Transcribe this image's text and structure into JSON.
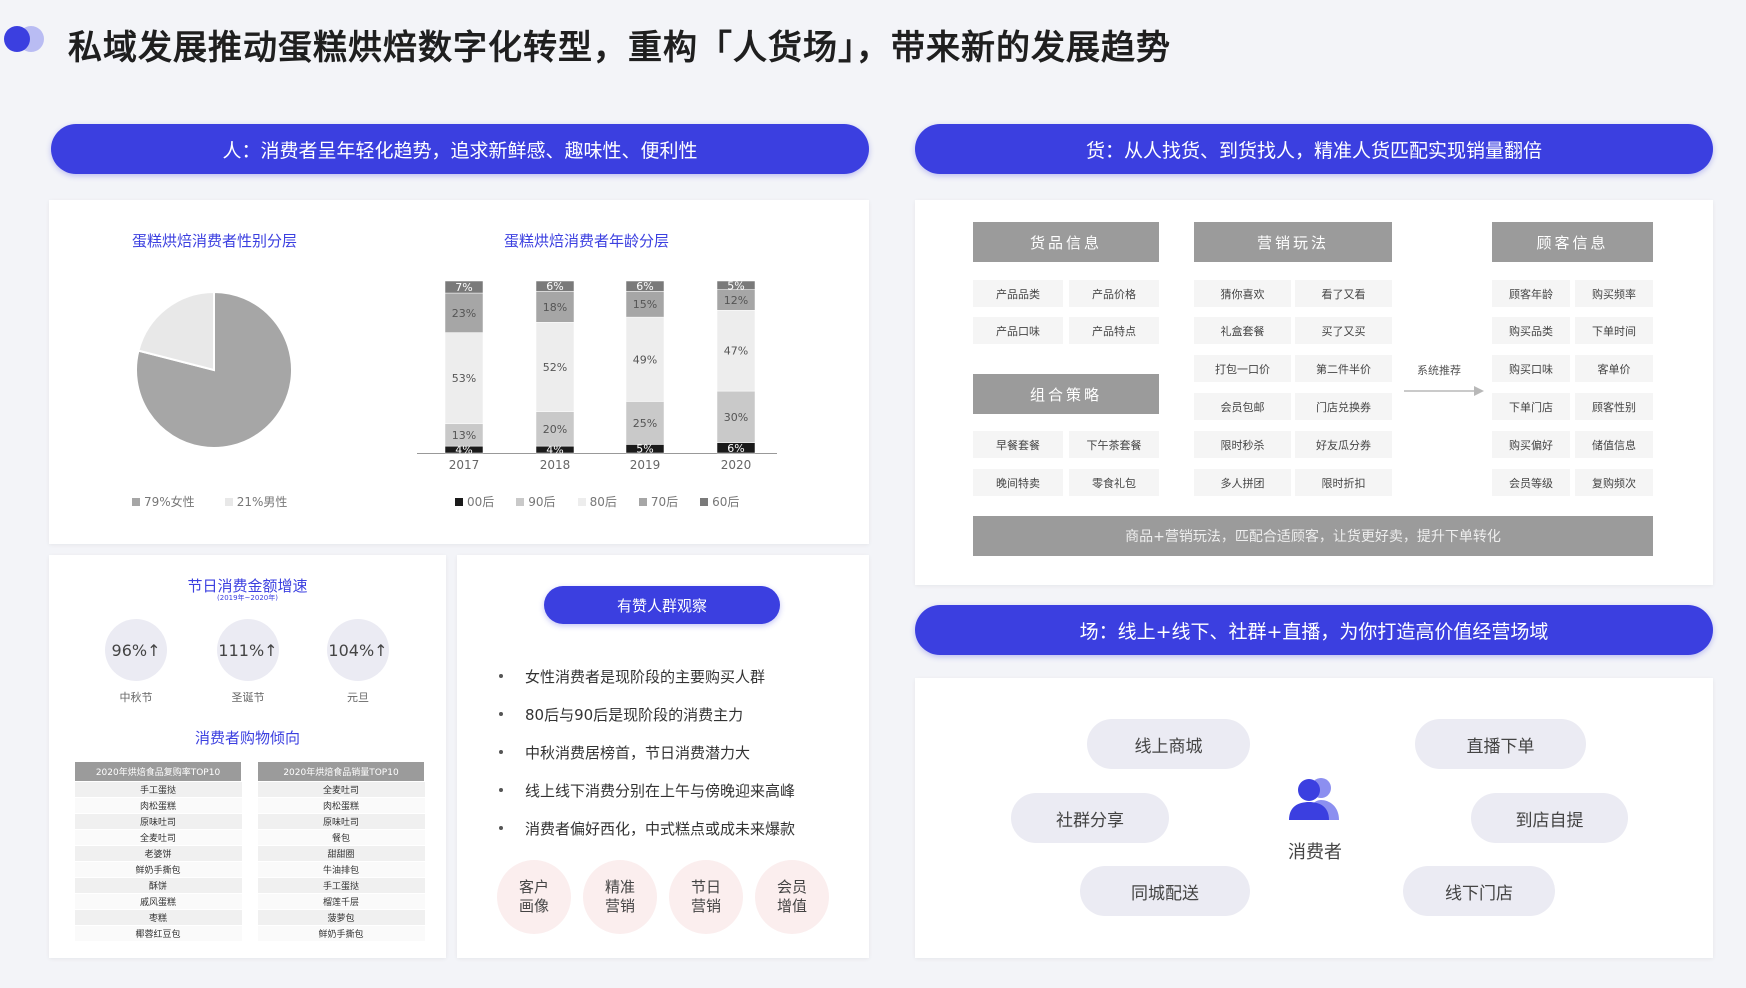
{
  "title": "私域发展推动蛋糕烘焙数字化转型，重构「人货场」，带来新的发展趋势",
  "colors": {
    "accent": "#3b3fe0"
  },
  "people": {
    "banner": "人：消费者呈年轻化趋势，追求新鲜感、趣味性、便利性",
    "holiday": {
      "title": "节日消费金额增速",
      "subtitle": "(2019年~2020年)",
      "items": [
        {
          "value": "96%↑",
          "label": "中秋节"
        },
        {
          "value": "111%↑",
          "label": "圣诞节"
        },
        {
          "value": "104%↑",
          "label": "元旦"
        }
      ]
    },
    "shopping": {
      "title": "消费者购物倾向",
      "table1": {
        "header": "2020年烘焙食品复购率TOP10",
        "rows": [
          "手工蛋挞",
          "肉松蛋糕",
          "原味吐司",
          "全麦吐司",
          "老婆饼",
          "鲜奶手撕包",
          "酥饼",
          "戚风蛋糕",
          "枣糕",
          "椰蓉红豆包"
        ]
      },
      "table2": {
        "header": "2020年烘焙食品销量TOP10",
        "rows": [
          "全麦吐司",
          "肉松蛋糕",
          "原味吐司",
          "餐包",
          "甜甜圈",
          "牛油排包",
          "手工蛋挞",
          "榴莲千层",
          "菠萝包",
          "鲜奶手撕包"
        ]
      }
    },
    "observation": {
      "title": "有赞人群观察",
      "bullets": [
        "女性消费者是现阶段的主要购买人群",
        "80后与90后是现阶段的消费主力",
        "中秋消费居榜首，节日消费潜力大",
        "线上线下消费分别在上午与傍晚迎来高峰",
        "消费者偏好西化，中式糕点或成未来爆款"
      ],
      "tags": [
        {
          "line1": "客户",
          "line2": "画像"
        },
        {
          "line1": "精准",
          "line2": "营销"
        },
        {
          "line1": "节日",
          "line2": "营销"
        },
        {
          "line1": "会员",
          "line2": "增值"
        }
      ]
    }
  },
  "chart_data": [
    {
      "type": "pie",
      "title": "蛋糕烘焙消费者性别分层",
      "series": [
        {
          "name": "79%女性",
          "value": 79,
          "color": "#a6a6a6"
        },
        {
          "name": "21%男性",
          "value": 21,
          "color": "#e8e8e8"
        }
      ]
    },
    {
      "type": "bar",
      "stacked": true,
      "title": "蛋糕烘焙消费者年龄分层",
      "categories": [
        "2017",
        "2018",
        "2019",
        "2020"
      ],
      "series": [
        {
          "name": "00后",
          "color": "#1a1a1a",
          "values": [
            4,
            4,
            5,
            6
          ]
        },
        {
          "name": "90后",
          "color": "#c9c9c9",
          "values": [
            13,
            20,
            25,
            30
          ]
        },
        {
          "name": "80后",
          "color": "#ededed",
          "values": [
            53,
            52,
            49,
            47
          ]
        },
        {
          "name": "70后",
          "color": "#a6a6a6",
          "values": [
            23,
            18,
            15,
            12
          ]
        },
        {
          "name": "60后",
          "color": "#7a7a7a",
          "values": [
            7,
            6,
            6,
            5
          ]
        }
      ],
      "ylim": [
        0,
        100
      ]
    }
  ],
  "goods": {
    "banner": "货：从人找货、到货找人，精准人货匹配实现销量翻倍",
    "product_info": {
      "title": "货品信息",
      "cells": [
        "产品品类",
        "产品价格",
        "产品口味",
        "产品特点"
      ]
    },
    "combo": {
      "title": "组合策略",
      "cells": [
        "早餐套餐",
        "下午茶套餐",
        "晚间特卖",
        "零食礼包"
      ]
    },
    "marketing": {
      "title": "营销玩法",
      "cells": [
        "猜你喜欢",
        "看了又看",
        "礼盒套餐",
        "买了又买",
        "打包一口价",
        "第二件半价",
        "会员包邮",
        "门店兑换券",
        "限时秒杀",
        "好友瓜分券",
        "多人拼团",
        "限时折扣"
      ]
    },
    "recommend": "系统推荐",
    "customer": {
      "title": "顾客信息",
      "cells": [
        "顾客年龄",
        "购买频率",
        "购买品类",
        "下单时间",
        "购买口味",
        "客单价",
        "下单门店",
        "顾客性别",
        "购买偏好",
        "储值信息",
        "会员等级",
        "复购频次"
      ]
    },
    "footer": "商品+营销玩法，匹配合适顾客，让货更好卖，提升下单转化"
  },
  "place": {
    "banner": "场：线上+线下、社群+直播，为你打造高价值经营场域",
    "center": "消费者",
    "icon": "users-icon",
    "items": [
      "线上商城",
      "直播下单",
      "社群分享",
      "到店自提",
      "同城配送",
      "线下门店"
    ]
  }
}
